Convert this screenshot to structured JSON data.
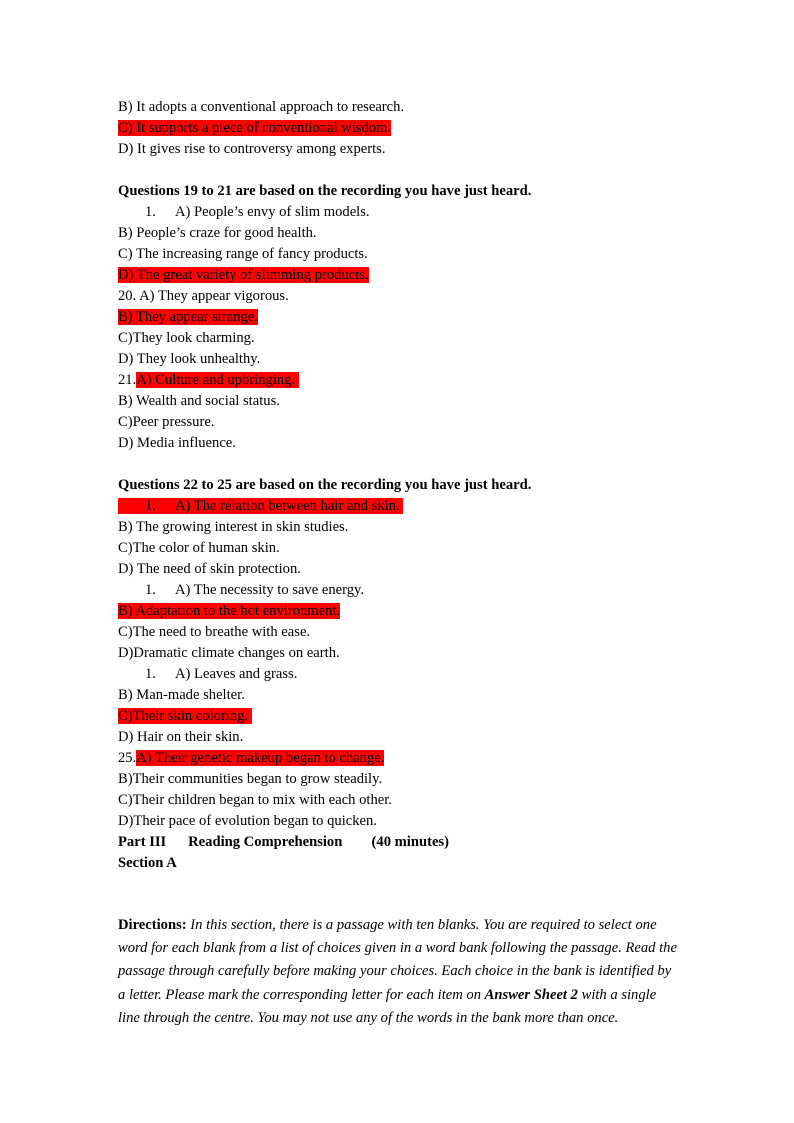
{
  "document": {
    "highlight_color": "#FF0000",
    "background_color": "#FFFFFF",
    "text_color": "#000000"
  },
  "block1": {
    "lines": [
      {
        "text": "B) It adopts a conventional approach to research.",
        "highlighted": false
      },
      {
        "text": "C) It supports a piece of conventional wisdom.",
        "highlighted": true
      },
      {
        "text": "D) It gives rise to controversy among experts.",
        "highlighted": false
      }
    ]
  },
  "block2": {
    "heading": "Questions 19 to 21 are based on the recording you have just heard.",
    "item_number": "1.",
    "item_text": "A) People’s envy of slim models.",
    "lines": [
      {
        "text": "B) People’s craze for good health.",
        "highlighted": false
      },
      {
        "text": "C) The increasing range of fancy products.",
        "highlighted": false
      },
      {
        "text": "D) The great variety of slimming products.",
        "highlighted": true
      },
      {
        "text": "20. A) They appear vigorous.",
        "highlighted": false
      },
      {
        "text": "B) They appear strange.",
        "highlighted": true
      },
      {
        "text": "C)They look charming.",
        "highlighted": false
      },
      {
        "text": "D) They look unhealthy.",
        "highlighted": false
      }
    ],
    "q21_prefix": "21.",
    "q21_answer": "A) Culture and upbringing. ",
    "lines_after": [
      {
        "text": "B) Wealth and social status.",
        "highlighted": false
      },
      {
        "text": "C)Peer pressure.",
        "highlighted": false
      },
      {
        "text": "D) Media influence.",
        "highlighted": false
      }
    ]
  },
  "block3": {
    "heading": "Questions 22 to 25 are based on the recording you have just heard.",
    "item1_number": "1.",
    "item1_text": "A) The relation between hair and skin. ",
    "lines1": [
      {
        "text": "B) The growing interest in skin studies.",
        "highlighted": false
      },
      {
        "text": "C)The color of human skin.",
        "highlighted": false
      },
      {
        "text": "D) The need of skin protection.",
        "highlighted": false
      }
    ],
    "item2_number": "1.",
    "item2_text": "A) The necessity to save energy.",
    "lines2": [
      {
        "text": "B) Adaptation to the hot environment.",
        "highlighted": true
      },
      {
        "text": "C)The need to breathe with ease.",
        "highlighted": false
      },
      {
        "text": "D)Dramatic climate changes on earth.",
        "highlighted": false
      }
    ],
    "item3_number": "1.",
    "item3_text": "A) Leaves and grass.",
    "lines3": [
      {
        "text": "B) Man-made shelter.",
        "highlighted": false
      },
      {
        "text": "C)Their skin coloring. ",
        "highlighted": true
      },
      {
        "text": "D) Hair on their skin.",
        "highlighted": false
      }
    ],
    "q25_prefix": "25.",
    "q25_answer": "A) Their genetic makeup began to change.",
    "lines4": [
      {
        "text": "B)Their communities began to grow steadily.",
        "highlighted": false
      },
      {
        "text": "C)Their children began to mix with each other.",
        "highlighted": false
      },
      {
        "text": "D)Their pace of evolution began to quicken.",
        "highlighted": false
      }
    ]
  },
  "part3": {
    "part_label": "Part III",
    "part_title": "Reading Comprehension",
    "duration": "(40 minutes)",
    "section_label": "Section A"
  },
  "directions": {
    "label": "Directions:",
    "text_before_bold": " In this section, there is a passage with ten blanks. You are required to select one word for each blank from a list of choices given in a word bank following the passage. Read the passage through carefully before making your choices. Each choice in the bank is identified by a letter. Please mark the corresponding letter for each item on ",
    "bold_phrase": "Answer Sheet 2",
    "text_after_bold": " with a single line through the centre. You may not use any of the words in the bank more than once."
  }
}
